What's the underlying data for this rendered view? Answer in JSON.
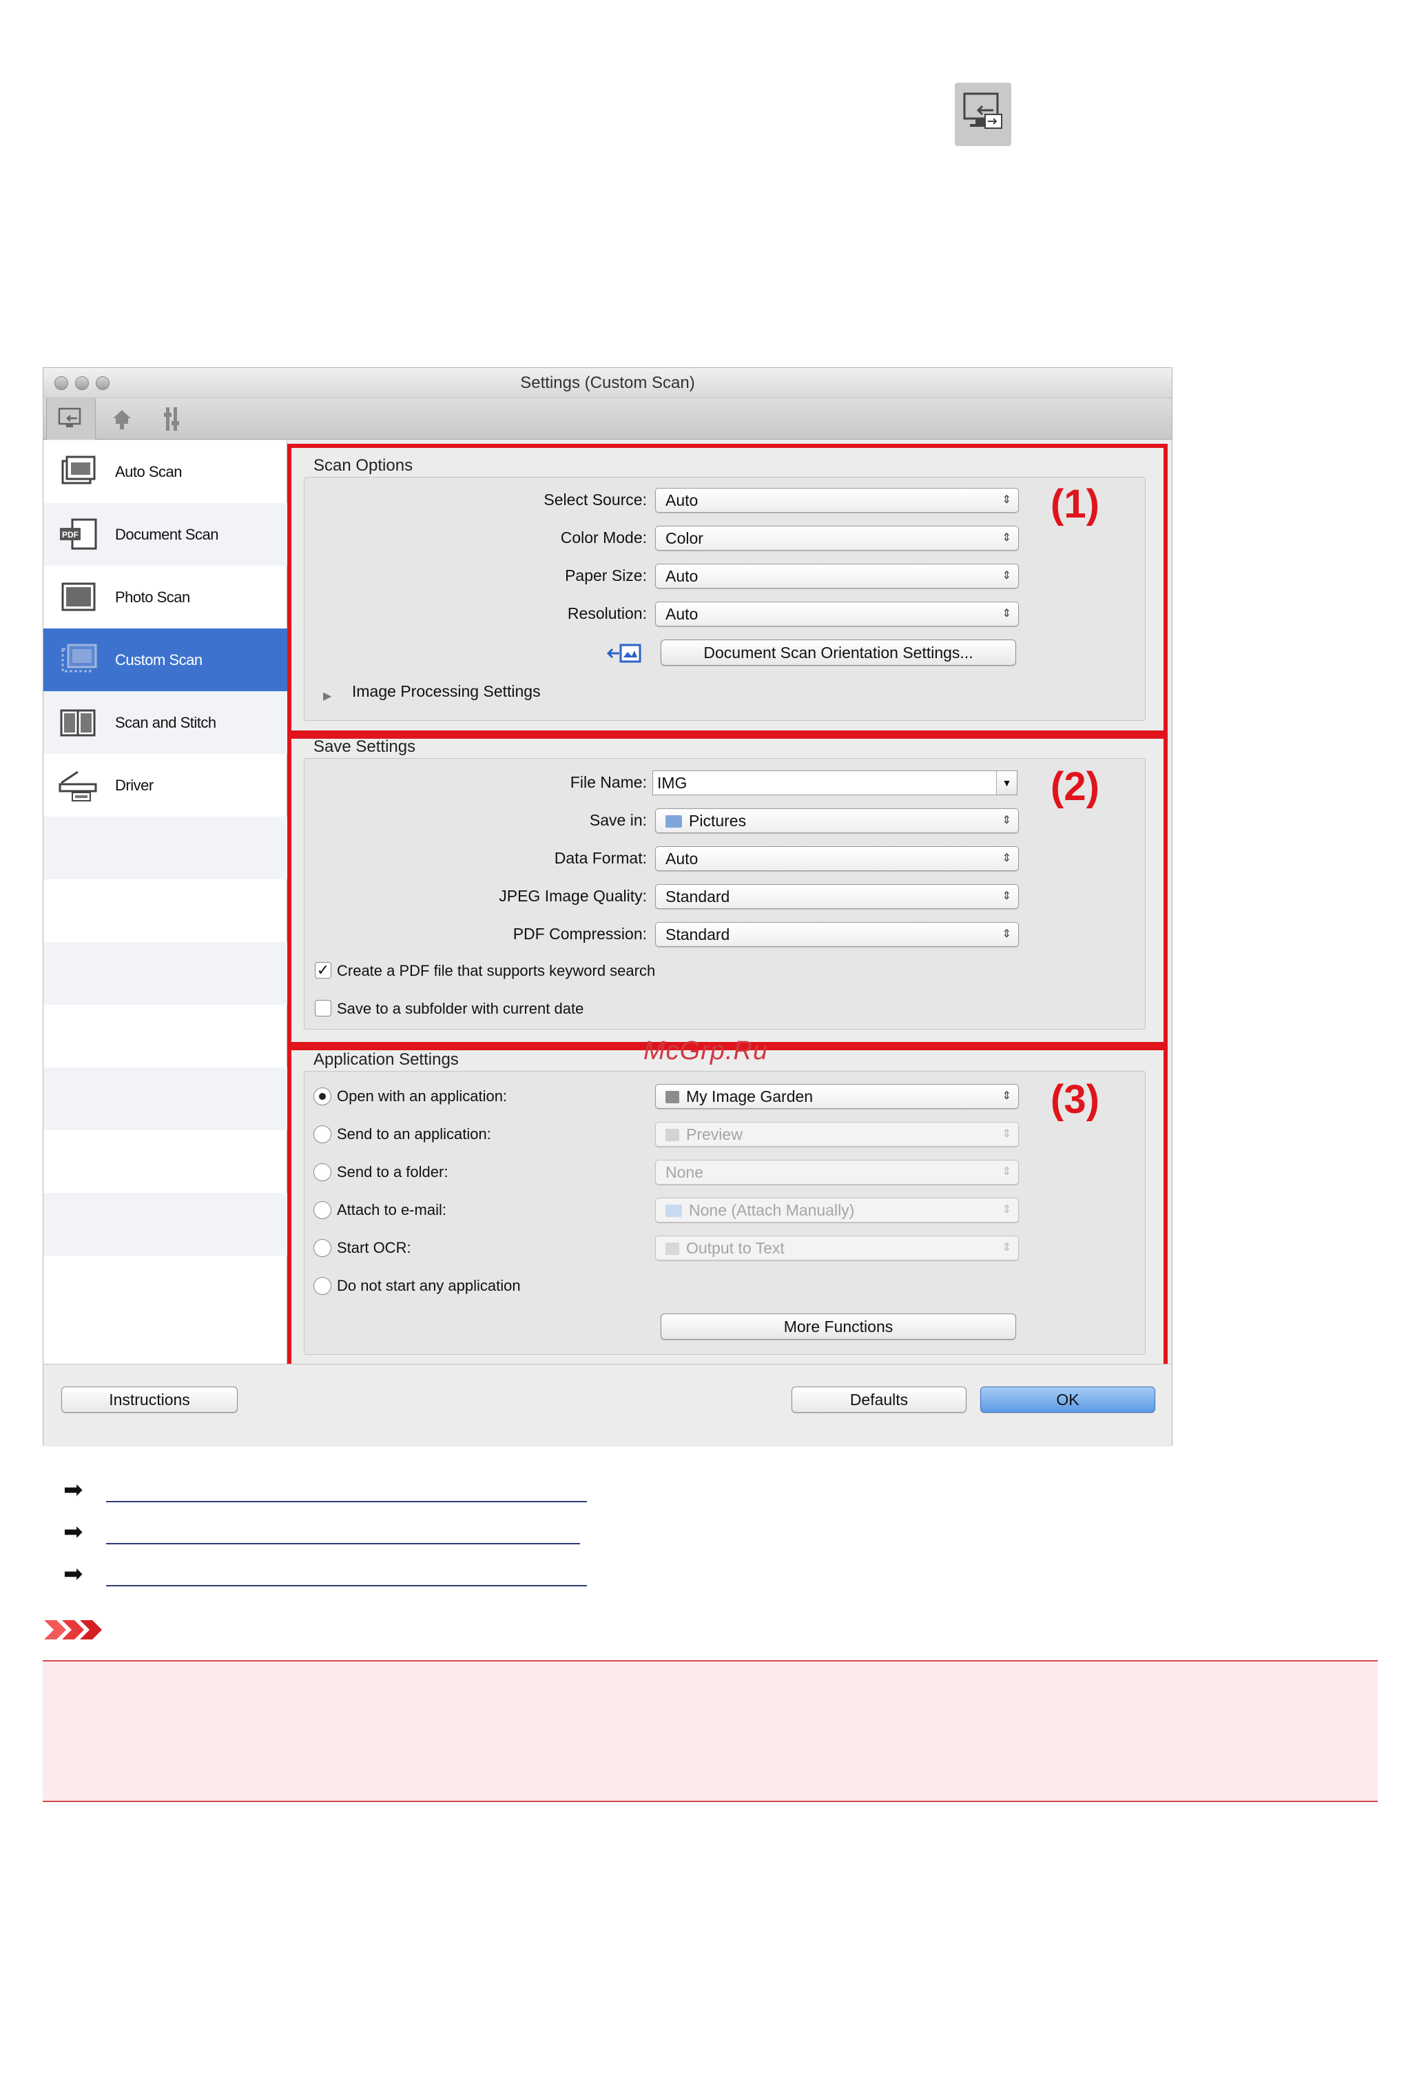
{
  "window": {
    "title": "Settings (Custom Scan)"
  },
  "sidebar": {
    "items": [
      {
        "label": "Auto Scan"
      },
      {
        "label": "Document Scan"
      },
      {
        "label": "Photo Scan"
      },
      {
        "label": "Custom Scan"
      },
      {
        "label": "Scan and Stitch"
      },
      {
        "label": "Driver"
      }
    ]
  },
  "scan_options": {
    "title": "Scan Options",
    "number": "(1)",
    "select_source": {
      "label": "Select Source:",
      "value": "Auto"
    },
    "color_mode": {
      "label": "Color Mode:",
      "value": "Color"
    },
    "paper_size": {
      "label": "Paper Size:",
      "value": "Auto"
    },
    "resolution": {
      "label": "Resolution:",
      "value": "Auto"
    },
    "orientation_button": "Document Scan Orientation Settings...",
    "image_processing": "Image Processing Settings"
  },
  "save_settings": {
    "title": "Save Settings",
    "number": "(2)",
    "file_name": {
      "label": "File Name:",
      "value": "IMG"
    },
    "save_in": {
      "label": "Save in:",
      "value": "Pictures"
    },
    "data_format": {
      "label": "Data Format:",
      "value": "Auto"
    },
    "jpeg_quality": {
      "label": "JPEG Image Quality:",
      "value": "Standard"
    },
    "pdf_compression": {
      "label": "PDF Compression:",
      "value": "Standard"
    },
    "keyword_search": "Create a PDF file that supports keyword search",
    "subfolder": "Save to a subfolder with current date"
  },
  "application_settings": {
    "title": "Application Settings",
    "number": "(3)",
    "open_with": {
      "label": "Open with an application:",
      "value": "My Image Garden"
    },
    "send_to_app": {
      "label": "Send to an application:",
      "value": "Preview"
    },
    "send_to_folder": {
      "label": "Send to a folder:",
      "value": "None"
    },
    "attach_email": {
      "label": "Attach to e-mail:",
      "value": "None (Attach Manually)"
    },
    "start_ocr": {
      "label": "Start OCR:",
      "value": "Output to Text"
    },
    "no_app": "Do not start any application",
    "more_functions": "More Functions"
  },
  "footer": {
    "instructions": "Instructions",
    "defaults": "Defaults",
    "ok": "OK"
  },
  "watermark": "McGrp.Ru",
  "colors": {
    "highlight_frame": "#e0141c",
    "selected_sidebar": "#3d73cf",
    "ok_button": "#5c9ae6"
  }
}
